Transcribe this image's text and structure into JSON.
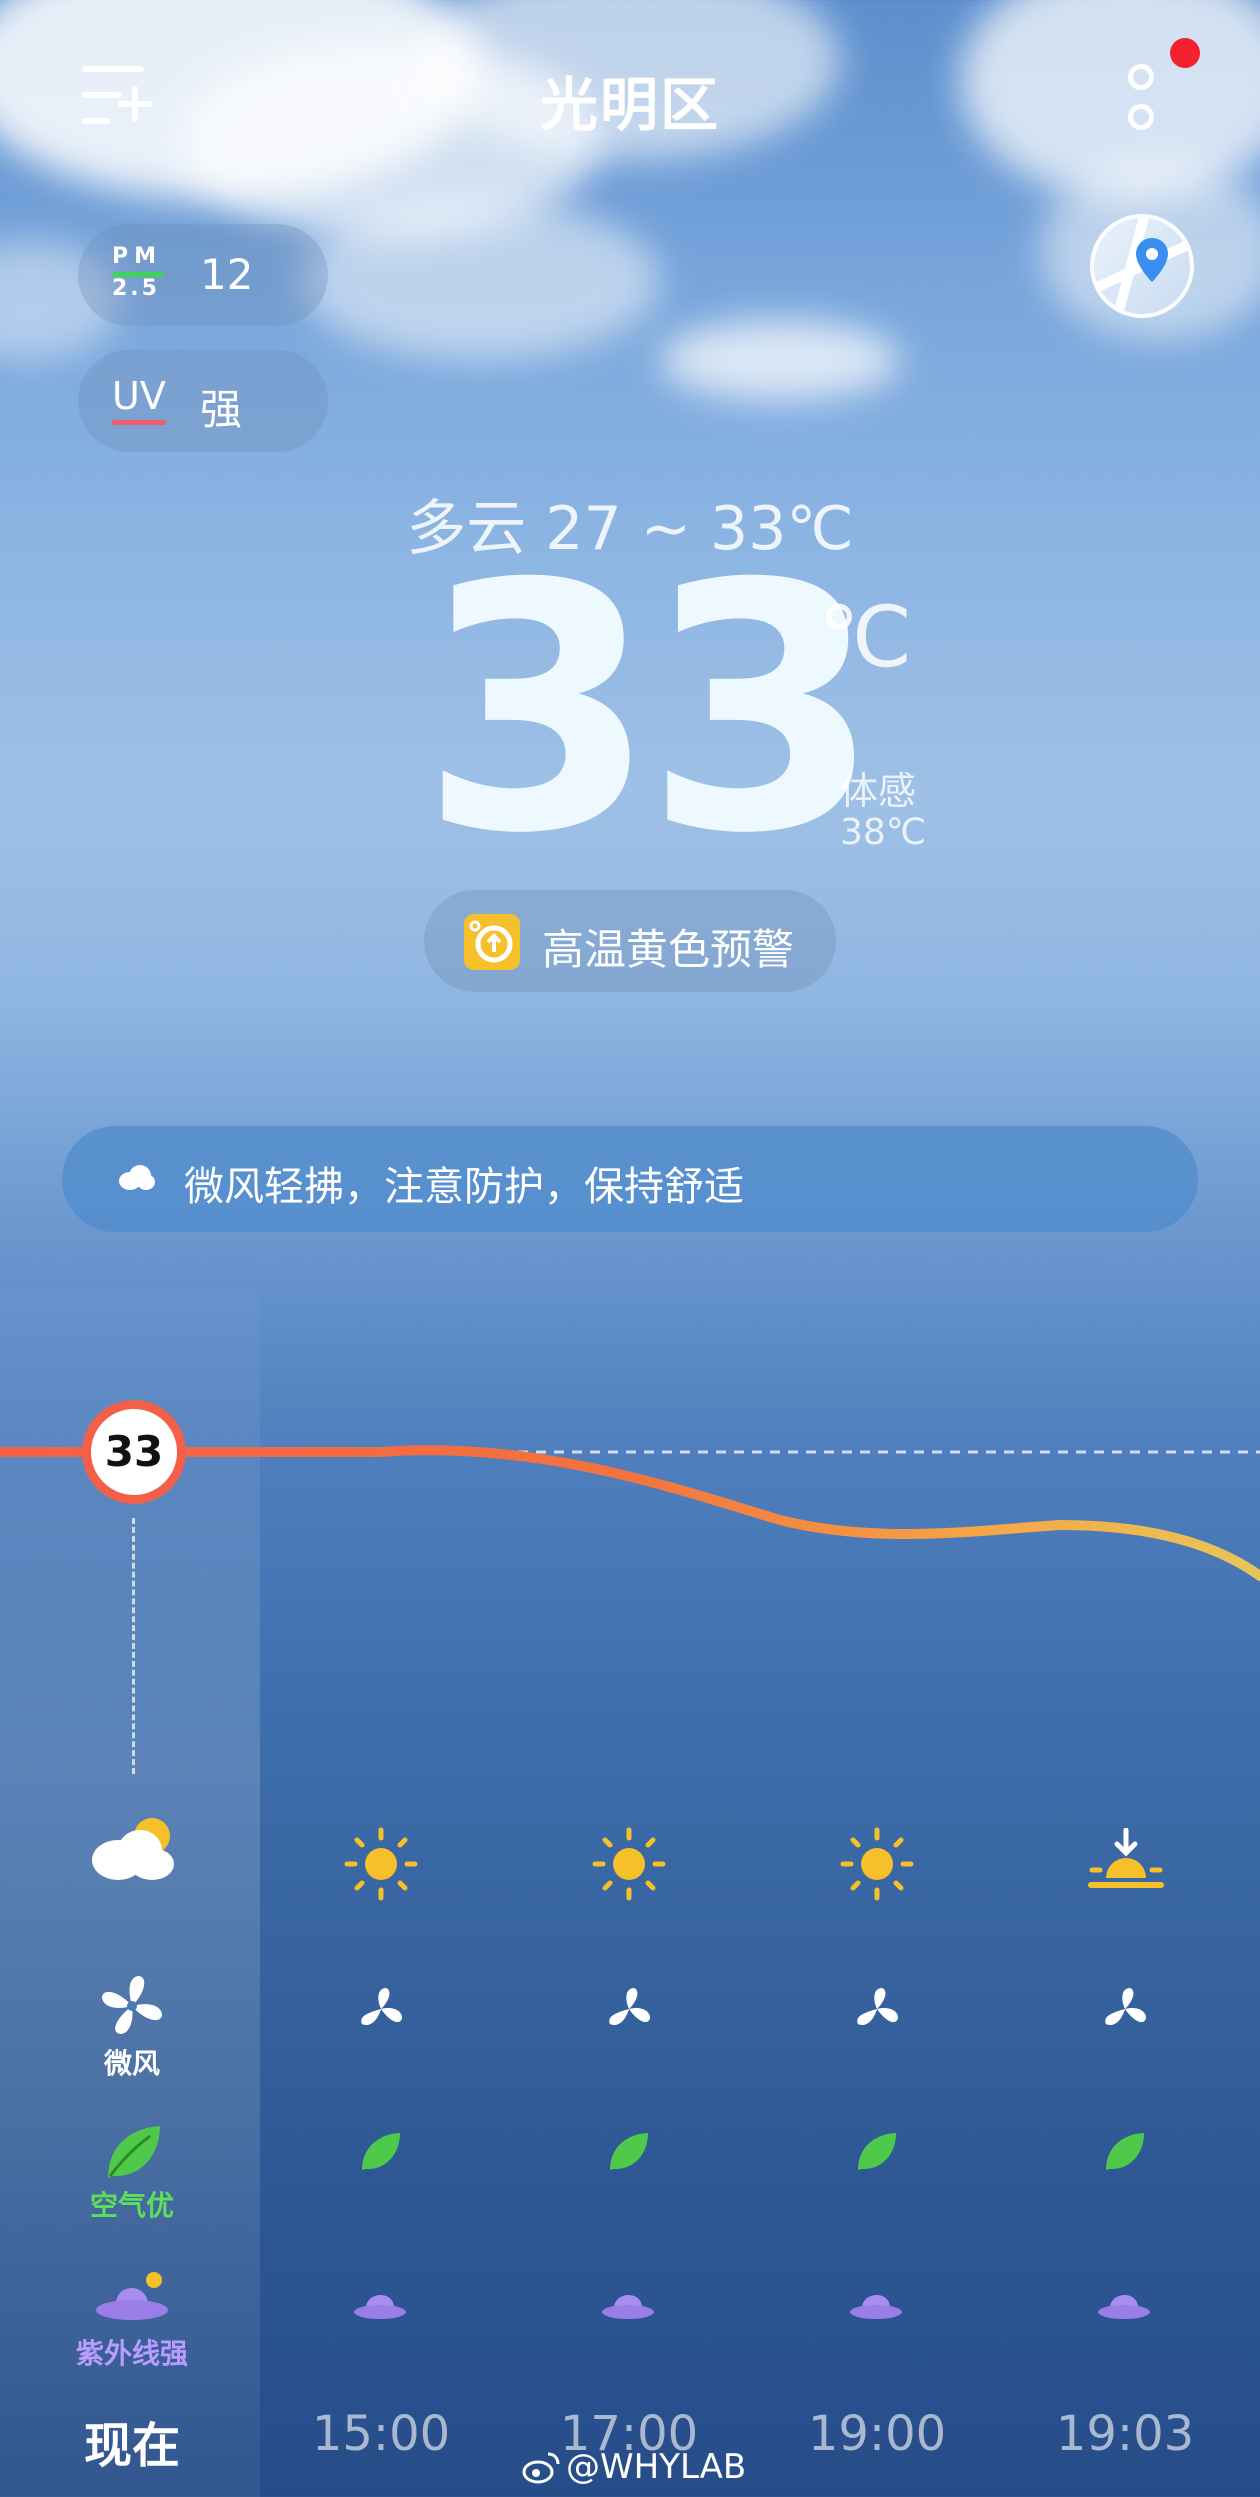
{
  "header": {
    "title": "光明区",
    "menu_icon": "menu-add-icon",
    "more_icon": "more-vertical-icon",
    "map_icon": "map-location-icon"
  },
  "air": {
    "pm_label_top": "PM",
    "pm_label_bottom": "2.5",
    "pm_value": "12",
    "uv_label": "UV",
    "uv_value": "强"
  },
  "current": {
    "condition": "多云  27 ~ 33℃",
    "temperature": "33",
    "unit": "℃",
    "feels_label": "体感",
    "feels_value": "38℃"
  },
  "warning": {
    "icon": "heat-warning-icon",
    "text": "高温黄色预警",
    "color": "#f6c02b"
  },
  "tip": {
    "icon": "cloud-icon",
    "text": "微风轻拂，注意防护，保持舒适"
  },
  "hourly": {
    "now_temperature": "33",
    "row_labels": {
      "wind": "微风",
      "air": "空气优",
      "uv": "紫外线强"
    },
    "times": [
      "现在",
      "15:00",
      "17:00",
      "19:00",
      "19:03"
    ],
    "weather_icons": [
      "cloudy-sun-icon",
      "sun-icon",
      "sun-icon",
      "sun-icon",
      "sunset-icon"
    ],
    "temperature_curve_color_start": "#f3604a",
    "temperature_curve_color_end": "#e6c65a"
  },
  "watermark": "@WHYLAB"
}
